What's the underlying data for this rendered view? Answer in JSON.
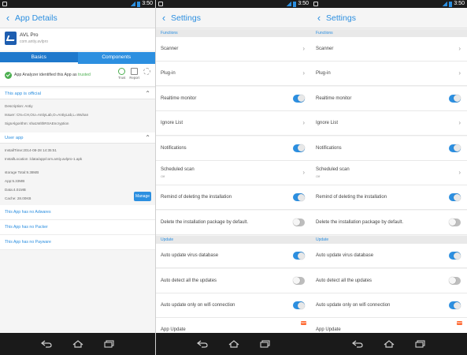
{
  "status": {
    "time": "3:50"
  },
  "app_details": {
    "title": "App Details",
    "app_name": "AVL Pro",
    "app_package": "com.antiy.avlpro",
    "tabs": [
      {
        "label": "Basics"
      },
      {
        "label": "Components"
      }
    ],
    "verdict_prefix": "App Analyzer identified this App as",
    "verdict_status": "trusted",
    "actions": [
      {
        "label": "Trust"
      },
      {
        "label": "Report"
      }
    ],
    "official_title": "This app is official",
    "official_lines": [
      "Description: Antiy",
      "Issuer: CN=CH,OU=AntiyLab,O=AntiyLab,L=Wuhan",
      "SignAlgorithm: sha1WithRSAEncryption"
    ],
    "user_app_title": "User app",
    "install_lines": [
      "InstallTime:2014-08-28 14:35:51",
      "InstallLocation :/data/app/com.antiy.avlpro-1.apk"
    ],
    "storage_lines": [
      "storage Total:9.38MB",
      "App:5.33MB",
      "Data:4.01MB",
      "Cache: 28.00KB"
    ],
    "manage_label": "Manage",
    "links": [
      {
        "label": "This App has no Adwares"
      },
      {
        "label": "This App has no Packer"
      },
      {
        "label": "This App has no Payware"
      }
    ]
  },
  "settings": {
    "title": "Settings",
    "functions_header": "Functions",
    "update_header": "Update",
    "functions": [
      {
        "label": "Scanner",
        "kind": "arrow"
      },
      {
        "label": "Plug-in",
        "kind": "arrow"
      },
      {
        "label": "Realtime monitor",
        "kind": "toggle",
        "on": true
      },
      {
        "label": "Ignore List",
        "kind": "arrow"
      },
      {
        "label": "Notifications",
        "kind": "toggle",
        "on": true
      },
      {
        "label": "Scheduled scan",
        "sub": "Off",
        "kind": "arrow"
      },
      {
        "label": "Remind of deleting the installation",
        "kind": "toggle",
        "on": true
      },
      {
        "label": "Delete the installation package by default.",
        "kind": "toggle",
        "on": false
      }
    ],
    "update": [
      {
        "label": "Auto update virus database",
        "kind": "toggle",
        "on": true
      },
      {
        "label": "Auto detect all the updates",
        "kind": "toggle",
        "on": false
      },
      {
        "label": "Auto update only on wifi connection",
        "kind": "toggle",
        "on": true
      },
      {
        "label": "App Update",
        "kind": "badge",
        "badge": "NEW"
      }
    ]
  }
}
